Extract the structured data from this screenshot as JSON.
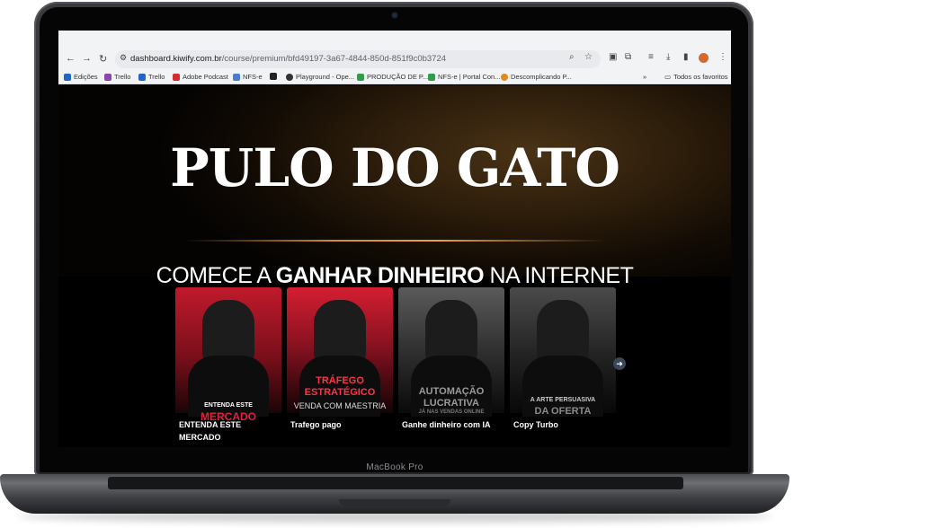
{
  "browser": {
    "url_host": "dashboard.kiwify.com.br",
    "url_path": "/course/premium/bfd49197-3a67-4844-850d-851f9c0b3724",
    "bookmarks": [
      {
        "label": "Edições",
        "color": "#1e66c8"
      },
      {
        "label": "Trello",
        "color": "#8e44ad"
      },
      {
        "label": "Trello",
        "color": "#1e66c8"
      },
      {
        "label": "Adobe Podcast",
        "color": "#d22c2c"
      },
      {
        "label": "NFS-e",
        "color": "#4a7bd0"
      },
      {
        "label": "",
        "color": "#222222"
      },
      {
        "label": "Playground - Ope...",
        "color": "#333333"
      },
      {
        "label": "PRODUÇÃO DE P...",
        "color": "#2e9e4a"
      },
      {
        "label": "NFS-e | Portal Con...",
        "color": "#2e9e4a"
      },
      {
        "label": "Descomplicando P...",
        "color": "#e08a1e"
      }
    ],
    "more_bookmarks": "»",
    "all_bookmarks_label": "Todos os favoritos"
  },
  "hero": {
    "title": "PULO DO GATO",
    "subtitle_pre": "COMECE A ",
    "subtitle_bold": "GANHAR DINHEIRO",
    "subtitle_post": " NA INTERNET"
  },
  "modules": [
    {
      "label": "ENTENDA ESTE MERCADO",
      "art_top": "ENTENDA ESTE",
      "art_main": "MERCADO",
      "theme": "#c81b2e"
    },
    {
      "label": "Trafego pago",
      "art_top": "TRÁFEGO",
      "art_main": "ESTRATÉGICO",
      "art_sub": "VENDA COM MAESTRIA",
      "theme": "#d01c2f"
    },
    {
      "label": "Ganhe dinheiro com IA",
      "art_top": "AUTOMAÇÃO",
      "art_main": "LUCRATIVA",
      "art_sub": "JÁ NAS VENDAS ONLINE",
      "theme": "#6b6b6b"
    },
    {
      "label": "Copy Turbo",
      "art_top": "A ARTE PERSUASIVA",
      "art_main": "DA OFERTA",
      "theme": "#5a5a5a"
    }
  ],
  "device": {
    "brand": "MacBook Pro"
  }
}
